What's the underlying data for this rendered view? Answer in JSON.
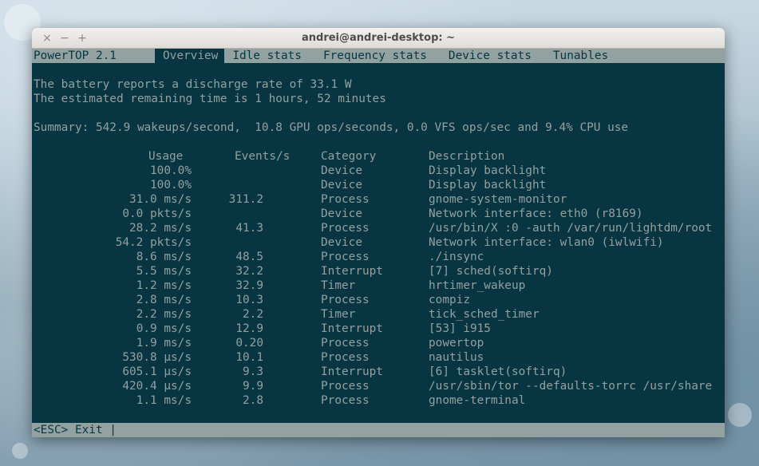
{
  "window": {
    "title": "andrei@andrei-desktop: ~",
    "close_label": "×",
    "minimize_label": "−",
    "maximize_label": "+"
  },
  "powertop": {
    "app_label": "PowerTOP 2.1",
    "tabs": [
      {
        "label": "Overview",
        "selected": true
      },
      {
        "label": "Idle stats",
        "selected": false
      },
      {
        "label": "Frequency stats",
        "selected": false
      },
      {
        "label": "Device stats",
        "selected": false
      },
      {
        "label": "Tunables",
        "selected": false
      }
    ],
    "battery_line": "The battery reports a discharge rate of 33.1 W",
    "remaining_line": "The estimated remaining time is 1 hours, 52 minutes",
    "summary_line": "Summary: 542.9 wakeups/second,  10.8 GPU ops/seconds, 0.0 VFS ops/sec and 9.4% CPU use",
    "headers": {
      "usage": "Usage",
      "events": "Events/s",
      "category": "Category",
      "description": "Description"
    },
    "rows": [
      {
        "usage": "100.0%",
        "events": "",
        "category": "Device",
        "description": "Display backlight"
      },
      {
        "usage": "100.0%",
        "events": "",
        "category": "Device",
        "description": "Display backlight"
      },
      {
        "usage": "31.0 ms/s",
        "events": "311.2",
        "category": "Process",
        "description": "gnome-system-monitor"
      },
      {
        "usage": "0.0 pkts/s",
        "events": "",
        "category": "Device",
        "description": "Network interface: eth0 (r8169)"
      },
      {
        "usage": "28.2 ms/s",
        "events": "41.3",
        "category": "Process",
        "description": "/usr/bin/X :0 -auth /var/run/lightdm/root"
      },
      {
        "usage": "54.2 pkts/s",
        "events": "",
        "category": "Device",
        "description": "Network interface: wlan0 (iwlwifi)"
      },
      {
        "usage": "8.6 ms/s",
        "events": "48.5",
        "category": "Process",
        "description": "./insync"
      },
      {
        "usage": "5.5 ms/s",
        "events": "32.2",
        "category": "Interrupt",
        "description": "[7] sched(softirq)"
      },
      {
        "usage": "1.2 ms/s",
        "events": "32.9",
        "category": "Timer",
        "description": "hrtimer_wakeup"
      },
      {
        "usage": "2.8 ms/s",
        "events": "10.3",
        "category": "Process",
        "description": "compiz"
      },
      {
        "usage": "2.2 ms/s",
        "events": "2.2",
        "category": "Timer",
        "description": "tick_sched_timer"
      },
      {
        "usage": "0.9 ms/s",
        "events": "12.9",
        "category": "Interrupt",
        "description": "[53] i915"
      },
      {
        "usage": "1.9 ms/s",
        "events": "0.20",
        "category": "Process",
        "description": "powertop"
      },
      {
        "usage": "530.8 μs/s",
        "events": "10.1",
        "category": "Process",
        "description": "nautilus"
      },
      {
        "usage": "605.1 μs/s",
        "events": "9.3",
        "category": "Interrupt",
        "description": "[6] tasklet(softirq)"
      },
      {
        "usage": "420.4 μs/s",
        "events": "9.9",
        "category": "Process",
        "description": "/usr/sbin/tor --defaults-torrc /usr/share"
      },
      {
        "usage": "1.1 ms/s",
        "events": "2.8",
        "category": "Process",
        "description": "gnome-terminal"
      }
    ],
    "status_line": "<ESC> Exit |"
  },
  "colors": {
    "terminal_bg": "#073642",
    "terminal_fg": "#93a1a1"
  }
}
